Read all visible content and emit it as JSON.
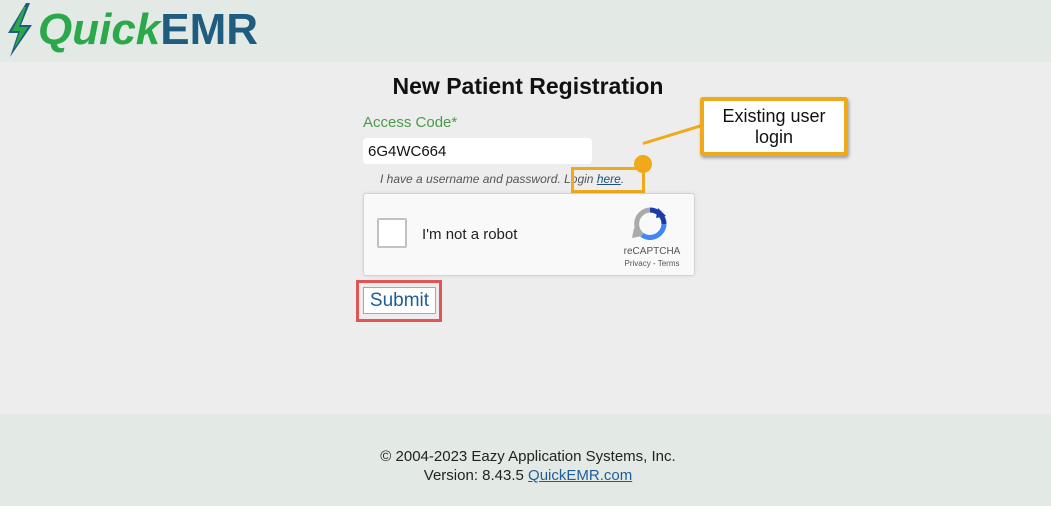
{
  "header": {
    "logo_quick": "Quick",
    "logo_emr": "EMR",
    "colors": {
      "quick": "#2aa84a",
      "emr": "#1f5d80",
      "bolt": "#1f5d80",
      "header_bg": "#e3eae5"
    }
  },
  "form": {
    "title": "New Patient Registration",
    "access_label": "Access Code*",
    "access_value": "6G4WC664",
    "login_note_prefix": "I have a username and password. Login ",
    "login_link": "here",
    "login_note_suffix": "."
  },
  "recaptcha": {
    "label": "I'm not a robot",
    "brand": "reCAPTCHA",
    "privacy": "Privacy",
    "separator": " - ",
    "terms": "Terms",
    "checked": false
  },
  "submit_label": "Submit",
  "callout": {
    "text_line1": "Existing user",
    "text_line2": "login",
    "color": "#f0a919"
  },
  "submit_highlight_color": "#e35555",
  "footer": {
    "copyright": "© 2004-2023 Eazy Application Systems, Inc.",
    "version_prefix": "Version: 8.43.5 ",
    "site_link": "QuickEMR.com"
  }
}
